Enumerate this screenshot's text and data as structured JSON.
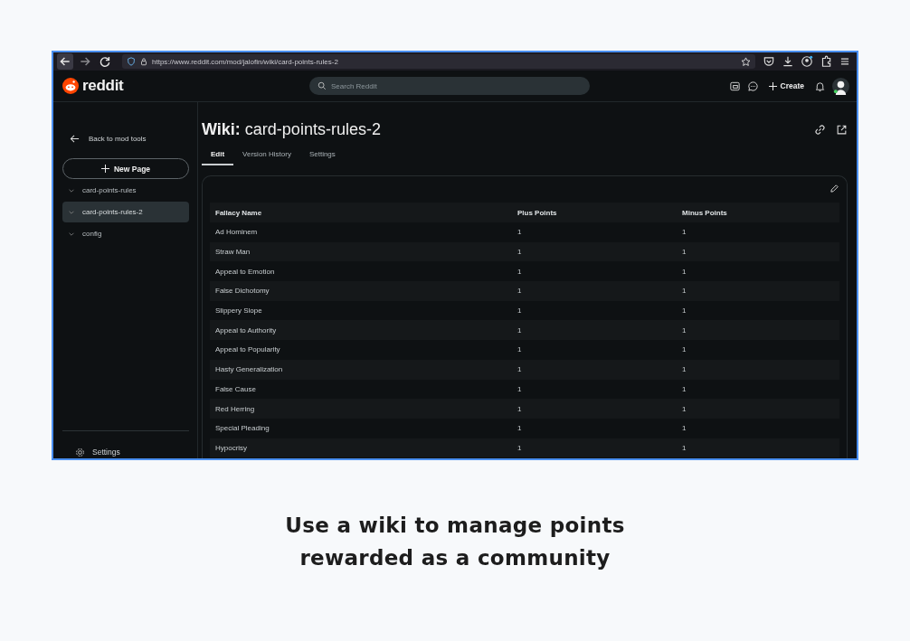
{
  "browser": {
    "url": "https://www.reddit.com/mod/jalofin/wiki/card-points-rules-2"
  },
  "header": {
    "logo": "reddit",
    "search": {
      "placeholder": "Search Reddit"
    },
    "create": "Create"
  },
  "sidebar": {
    "back": "Back to mod tools",
    "new_page": "New Page",
    "pages": [
      {
        "label": "card-points-rules",
        "selected": false
      },
      {
        "label": "card-points-rules-2",
        "selected": true
      },
      {
        "label": "config",
        "selected": false
      }
    ],
    "settings": "Settings"
  },
  "main": {
    "title_prefix": "Wiki:",
    "title": "card-points-rules-2",
    "tabs": [
      {
        "label": "Edit",
        "selected": true
      },
      {
        "label": "Version History",
        "selected": false
      },
      {
        "label": "Settings",
        "selected": false
      }
    ],
    "table": {
      "columns": [
        "Fallacy Name",
        "Plus Points",
        "Minus Points"
      ],
      "rows": [
        [
          "Ad Hominem",
          "1",
          "1"
        ],
        [
          "Straw Man",
          "1",
          "1"
        ],
        [
          "Appeal to Emotion",
          "1",
          "1"
        ],
        [
          "False Dichotomy",
          "1",
          "1"
        ],
        [
          "Slippery Slope",
          "1",
          "1"
        ],
        [
          "Appeal to Authority",
          "1",
          "1"
        ],
        [
          "Appeal to Popularity",
          "1",
          "1"
        ],
        [
          "Hasty Generalization",
          "1",
          "1"
        ],
        [
          "False Cause",
          "1",
          "1"
        ],
        [
          "Red Herring",
          "1",
          "1"
        ],
        [
          "Special Pleading",
          "1",
          "1"
        ],
        [
          "Hypocrisy",
          "1",
          "1"
        ]
      ]
    }
  },
  "caption": [
    "Use a wiki to manage points",
    "rewarded as a community"
  ]
}
